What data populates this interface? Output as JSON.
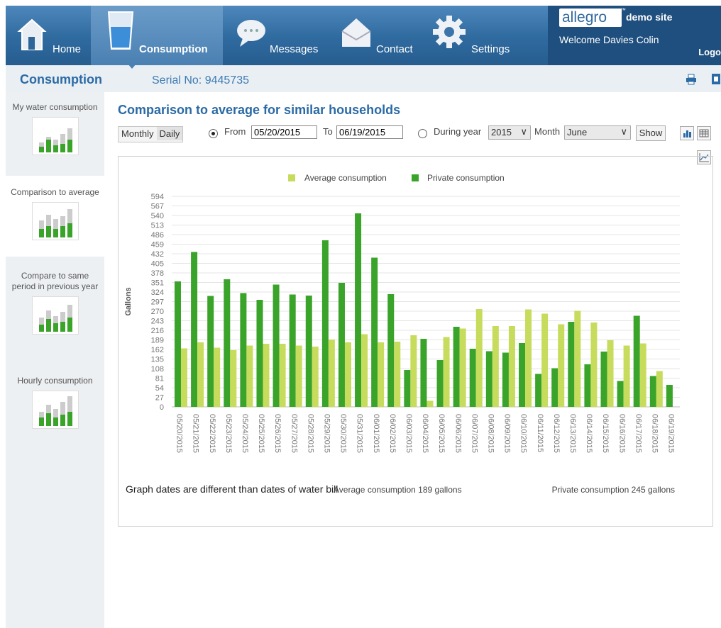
{
  "nav": {
    "items": [
      {
        "label": "Home",
        "icon": "home-icon"
      },
      {
        "label": "Consumption",
        "icon": "water-glass-icon",
        "active": true
      },
      {
        "label": "Messages",
        "icon": "speech-bubble-icon"
      },
      {
        "label": "Contact",
        "icon": "envelope-icon"
      },
      {
        "label": "Settings",
        "icon": "gear-icon"
      }
    ],
    "brand": "allegro",
    "demo_site": "demo site",
    "welcome": "Welcome Davies Colin",
    "logout": "Logo"
  },
  "subheader": {
    "title": "Consumption",
    "serial": "Serial No: 9445735"
  },
  "sidebar": {
    "items": [
      {
        "label": "My water consumption",
        "active": false
      },
      {
        "label": "Comparison to average",
        "active": true
      },
      {
        "label": "Compare to same period in previous year",
        "active": false
      },
      {
        "label": "Hourly consumption",
        "active": false
      }
    ]
  },
  "main": {
    "title": "Comparison to average for similar households",
    "toggle": {
      "monthly": "Monthly",
      "daily": "Daily",
      "selected": "Daily"
    },
    "from_label": "From",
    "from_value": "05/20/2015",
    "to_label": "To",
    "to_value": "06/19/2015",
    "during_year_label": "During year",
    "year_value": "2015",
    "month_label": "Month",
    "month_value": "June",
    "show_label": "Show",
    "range_mode": "from"
  },
  "footer": {
    "note": "Graph dates are different than dates of water bill",
    "avg_summary": "Average consumption  189 gallons",
    "private_summary": "Private consumption  245 gallons"
  },
  "colors": {
    "nav_bg": "#2f6a9f",
    "title_blue": "#2a6aa5",
    "average": "#c7dc5c",
    "private": "#3aa32a"
  },
  "chart_data": {
    "type": "bar",
    "ylabel": "Gallons",
    "ylim": [
      0,
      594
    ],
    "yticks": [
      0,
      27,
      54,
      81,
      108,
      135,
      162,
      189,
      216,
      243,
      270,
      297,
      324,
      351,
      378,
      405,
      432,
      459,
      486,
      513,
      540,
      567,
      594
    ],
    "legend_position": "top",
    "grid": true,
    "categories": [
      "05/20/2015",
      "05/21/2015",
      "05/22/2015",
      "05/23/2015",
      "05/24/2015",
      "05/25/2015",
      "05/26/2015",
      "05/27/2015",
      "05/28/2015",
      "05/29/2015",
      "05/30/2015",
      "05/31/2015",
      "06/01/2015",
      "06/02/2015",
      "06/03/2015",
      "06/04/2015",
      "06/05/2015",
      "06/06/2015",
      "06/07/2015",
      "06/08/2015",
      "06/09/2015",
      "06/10/2015",
      "06/11/2015",
      "06/12/2015",
      "06/13/2015",
      "06/14/2015",
      "06/15/2015",
      "06/16/2015",
      "06/17/2015",
      "06/18/2015",
      "06/19/2015"
    ],
    "series": [
      {
        "name": "Average consumption",
        "values": [
          165,
          182,
          167,
          160,
          173,
          178,
          178,
          173,
          170,
          190,
          182,
          205,
          182,
          184,
          202,
          17,
          197,
          221,
          276,
          228,
          228,
          275,
          263,
          233,
          271,
          238,
          188,
          173,
          179,
          101,
          null
        ]
      },
      {
        "name": "Private consumption",
        "values": [
          354,
          437,
          313,
          360,
          321,
          302,
          345,
          317,
          314,
          470,
          350,
          546,
          421,
          318,
          104,
          192,
          132,
          226,
          164,
          157,
          153,
          180,
          93,
          109,
          240,
          120,
          156,
          73,
          257,
          87,
          62
        ]
      }
    ]
  }
}
